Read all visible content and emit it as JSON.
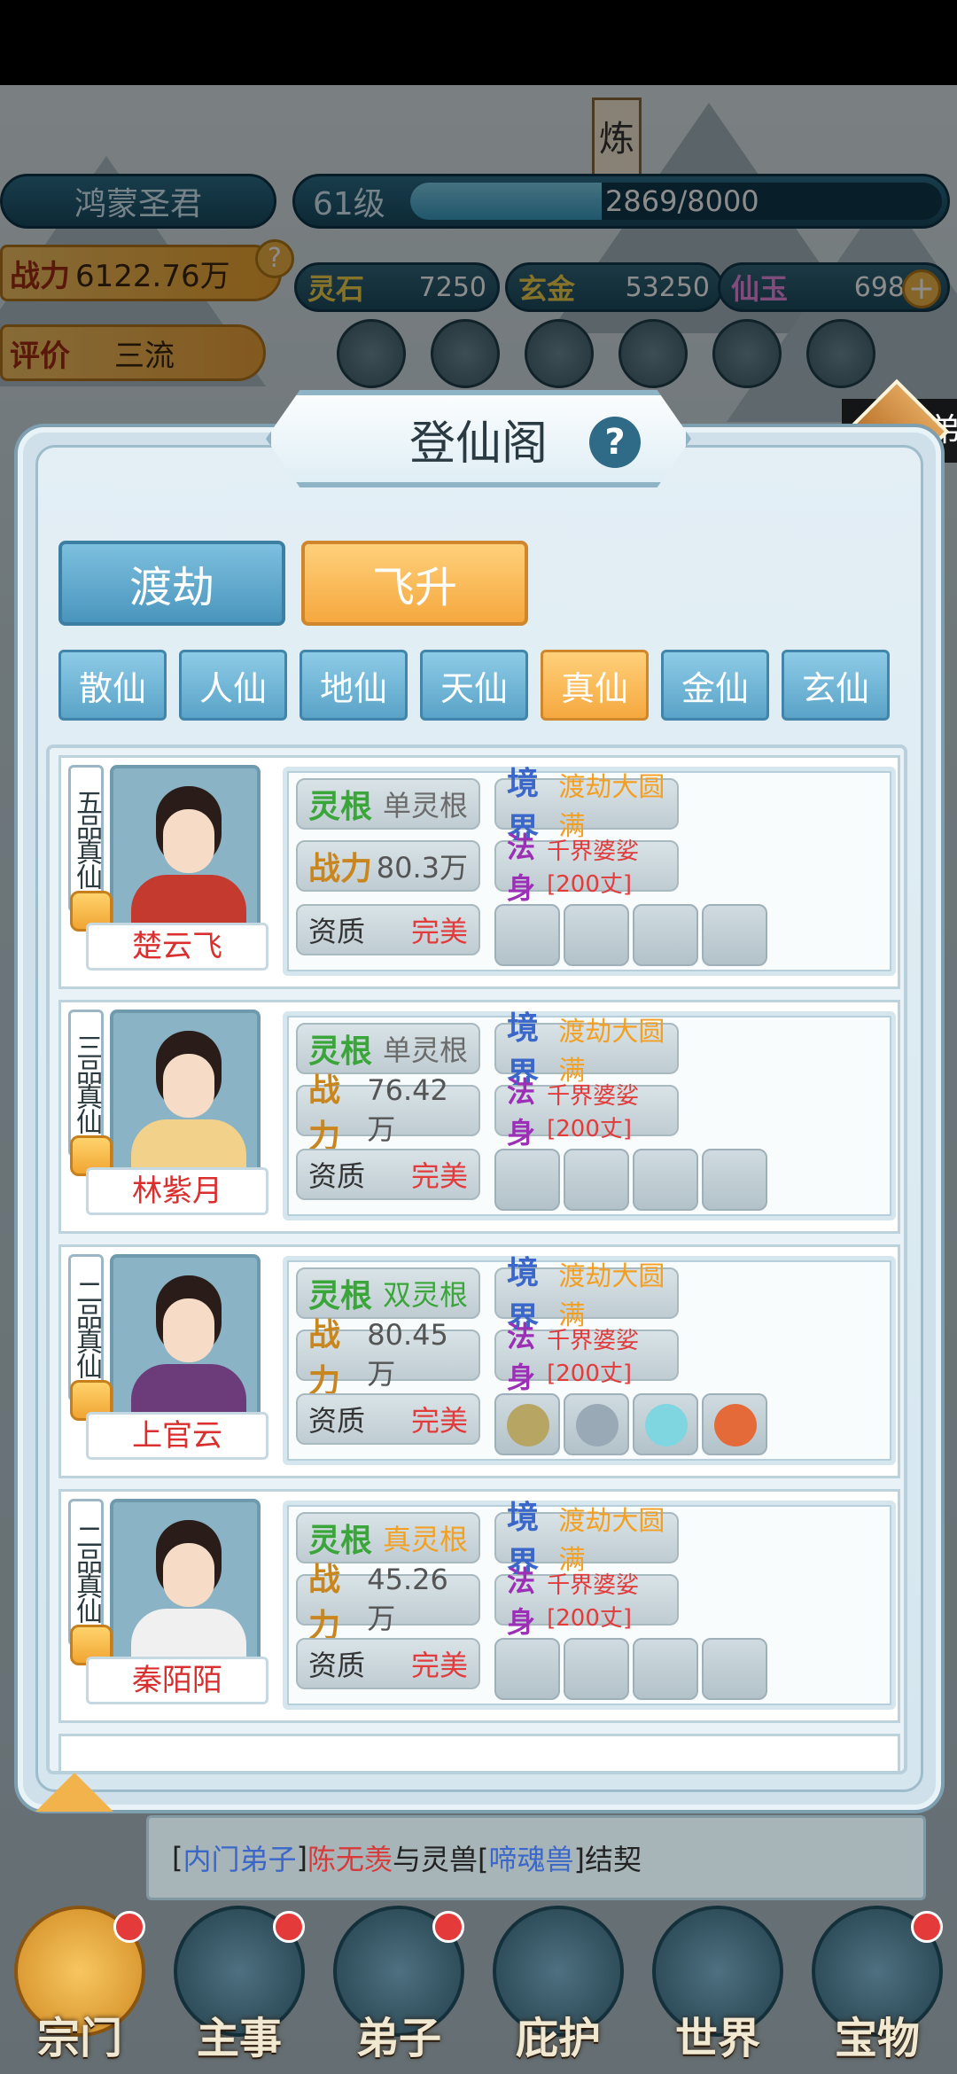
{
  "hud": {
    "player_name": "鸿蒙圣君",
    "level": "61级",
    "exp_text": "2869/8000",
    "exp_progress": 0.36,
    "power_label": "战力",
    "power_value": "6122.76万",
    "rating_label": "评价",
    "rating_value": "三流",
    "resources": [
      {
        "label": "灵石",
        "value": "7250"
      },
      {
        "label": "玄金",
        "value": "53250"
      },
      {
        "label": "仙玉",
        "value": "698"
      }
    ],
    "building_label": "炼"
  },
  "toast": "宗门弟",
  "panel": {
    "title": "登仙阁",
    "tabs": [
      {
        "label": "渡劫",
        "selected": false
      },
      {
        "label": "飞升",
        "selected": true
      }
    ],
    "ranks": [
      {
        "label": "散仙",
        "selected": false
      },
      {
        "label": "人仙",
        "selected": false
      },
      {
        "label": "地仙",
        "selected": false
      },
      {
        "label": "天仙",
        "selected": false
      },
      {
        "label": "真仙",
        "selected": true
      },
      {
        "label": "金仙",
        "selected": false
      },
      {
        "label": "玄仙",
        "selected": false
      }
    ],
    "labels": {
      "root": "灵根",
      "power": "战力",
      "aptitude": "资质",
      "realm": "境界",
      "body": "法身"
    },
    "cards": [
      {
        "grade": "五品真仙",
        "name": "楚云飞",
        "root": "单灵根",
        "root_color": "#6b6b6b",
        "power": "80.3万",
        "aptitude": "完美",
        "realm": "渡劫大圆满",
        "body": "千界婆娑[200丈]",
        "equipped": false
      },
      {
        "grade": "三品真仙",
        "name": "林紫月",
        "root": "单灵根",
        "root_color": "#6b6b6b",
        "power": "76.42万",
        "aptitude": "完美",
        "realm": "渡劫大圆满",
        "body": "千界婆娑[200丈]",
        "equipped": false
      },
      {
        "grade": "二品真仙",
        "name": "上官云",
        "root": "双灵根",
        "root_color": "#3aa63a",
        "power": "80.45万",
        "aptitude": "完美",
        "realm": "渡劫大圆满",
        "body": "千界婆娑[200丈]",
        "equipped": true
      },
      {
        "grade": "二品真仙",
        "name": "秦陌陌",
        "root": "真灵根",
        "root_color": "#f2a024",
        "power": "45.26万",
        "aptitude": "完美",
        "realm": "渡劫大圆满",
        "body": "千界婆娑[200丈]",
        "equipped": false
      }
    ]
  },
  "message": {
    "part1": "[",
    "role": "内门弟子",
    "part2": "]",
    "person": "陈无羡",
    "part3": "与灵兽[",
    "beast": "啼魂兽",
    "part4": "]结契"
  },
  "nav": [
    "宗门",
    "主事",
    "弟子",
    "庇护",
    "世界",
    "宝物"
  ],
  "colors": {
    "accent_orange": "#f5a83f",
    "accent_blue": "#4a95bd",
    "realm_orange": "#f2a024",
    "perfect_red": "#e23b3b"
  }
}
